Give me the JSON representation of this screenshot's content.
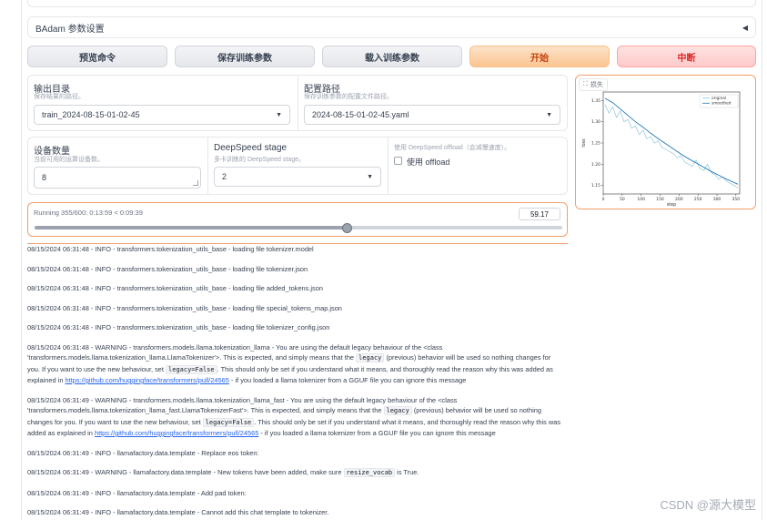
{
  "badam_label": "BAdam 参数设置",
  "buttons": {
    "preview": "预览命令",
    "save": "保存训练参数",
    "load": "载入训练参数",
    "start": "开始",
    "stop": "中断"
  },
  "output_dir": {
    "label": "输出目录",
    "info": "保存结果的路径。",
    "value": "train_2024-08-15-01-02-45"
  },
  "config_path": {
    "label": "配置路径",
    "info": "保存训练参数的配置文件路径。",
    "value": "2024-08-15-01-02-45.yaml"
  },
  "device_count": {
    "label": "设备数量",
    "info": "当前可用的运算设备数。",
    "value": "8"
  },
  "deepspeed_stage": {
    "label": "DeepSpeed stage",
    "info": "多卡训练的 DeepSpeed stage。",
    "value": "2"
  },
  "deepspeed_offload": {
    "info": "使用 DeepSpeed offload（会减慢速度）。",
    "label": "使用 offload",
    "checked": false
  },
  "progress": {
    "label": "Running 355/600: 0:13:59 < 0:09:39",
    "value": "59.17",
    "fraction": 0.5917
  },
  "loss_tag": "损失",
  "colors": {
    "accent": "#f59e6b",
    "original": "#93c5d8",
    "smoothed": "#1f77b4"
  },
  "chart_data": {
    "type": "line",
    "xlabel": "step",
    "ylabel": "loss",
    "xlim": [
      0,
      360
    ],
    "ylim": [
      1.13,
      1.37
    ],
    "xticks": [
      "0",
      "50",
      "100",
      "150",
      "200",
      "250",
      "300",
      "350"
    ],
    "yticks": [
      "1.15",
      "1.20",
      "1.25",
      "1.30",
      "1.35"
    ],
    "legend_placement": "top-right",
    "series": [
      {
        "name": "original",
        "x": [
          5,
          15,
          25,
          35,
          45,
          55,
          65,
          75,
          85,
          95,
          105,
          115,
          125,
          135,
          145,
          155,
          165,
          175,
          185,
          195,
          205,
          215,
          225,
          235,
          245,
          255,
          265,
          275,
          285,
          295,
          305,
          315,
          325,
          335,
          345,
          355
        ],
        "values": [
          1.34,
          1.32,
          1.335,
          1.31,
          1.325,
          1.3,
          1.305,
          1.285,
          1.29,
          1.27,
          1.28,
          1.26,
          1.265,
          1.25,
          1.255,
          1.24,
          1.235,
          1.23,
          1.225,
          1.215,
          1.22,
          1.205,
          1.2,
          1.195,
          1.21,
          1.19,
          1.185,
          1.2,
          1.18,
          1.175,
          1.165,
          1.17,
          1.16,
          1.155,
          1.15,
          1.145
        ]
      },
      {
        "name": "smoothed",
        "x": [
          5,
          25,
          45,
          65,
          85,
          105,
          125,
          145,
          165,
          185,
          205,
          225,
          245,
          265,
          285,
          305,
          325,
          345,
          355
        ],
        "values": [
          1.355,
          1.345,
          1.33,
          1.315,
          1.3,
          1.287,
          1.273,
          1.26,
          1.248,
          1.236,
          1.224,
          1.213,
          1.203,
          1.193,
          1.183,
          1.174,
          1.165,
          1.157,
          1.153
        ]
      }
    ]
  },
  "log_lines": [
    "08/15/2024 06:31:48 - INFO - transformers.tokenization_utils_base - loading file tokenizer.model",
    "08/15/2024 06:31:48 - INFO - transformers.tokenization_utils_base - loading file tokenizer.json",
    "08/15/2024 06:31:48 - INFO - transformers.tokenization_utils_base - loading file added_tokens.json",
    "08/15/2024 06:31:48 - INFO - transformers.tokenization_utils_base - loading file special_tokens_map.json",
    "08/15/2024 06:31:48 - INFO - transformers.tokenization_utils_base - loading file tokenizer_config.json"
  ],
  "warn1": {
    "a": "08/15/2024 06:31:48 - WARNING - transformers.models.llama.tokenization_llama - You are using the default legacy behaviour of the <class 'transformers.models.llama.tokenization_llama.LlamaTokenizer'>. This is expected, and simply means that the ",
    "code1": "legacy",
    "b": " (previous) behavior will be used so nothing changes for you. If you want to use the new behaviour, set ",
    "code2": "legacy=False",
    "c": ". This should only be set if you understand what it means, and thoroughly read the reason why this was added as explained in ",
    "link": "https://github.com/huggingface/transformers/pull/24565",
    "d": " - if you loaded a llama tokenizer from a GGUF file you can ignore this message"
  },
  "warn2": {
    "a": "08/15/2024 06:31:49 - WARNING - transformers.models.llama.tokenization_llama_fast - You are using the default legacy behaviour of the <class 'transformers.models.llama.tokenization_llama_fast.LlamaTokenizerFast'>. This is expected, and simply means that the ",
    "code1": "legacy",
    "b": " (previous) behavior will be used so nothing changes for you. If you want to use the new behaviour, set ",
    "code2": "legacy=False",
    "c": ". This should only be set if you understand what it means, and thoroughly read the reason why this was added as explained in ",
    "link": "https://github.com/huggingface/transformers/pull/24565",
    "d": " - if you loaded a llama tokenizer from a GGUF file you can ignore this message"
  },
  "log_tail": {
    "l1": "08/15/2024 06:31:49 - INFO - llamafactory.data.template - Replace eos token: ",
    "l2a": "08/15/2024 06:31:49 - WARNING - llamafactory.data.template - New tokens have been added, make sure ",
    "l2code": "resize_vocab",
    "l2b": " is True.",
    "l3": "08/15/2024 06:31:49 - INFO - llamafactory.data.template - Add pad token: ",
    "l4": "08/15/2024 06:31:49 - INFO - llamafactory.data.template - Cannot add this chat template to tokenizer."
  },
  "watermark": "CSDN @源大模型"
}
